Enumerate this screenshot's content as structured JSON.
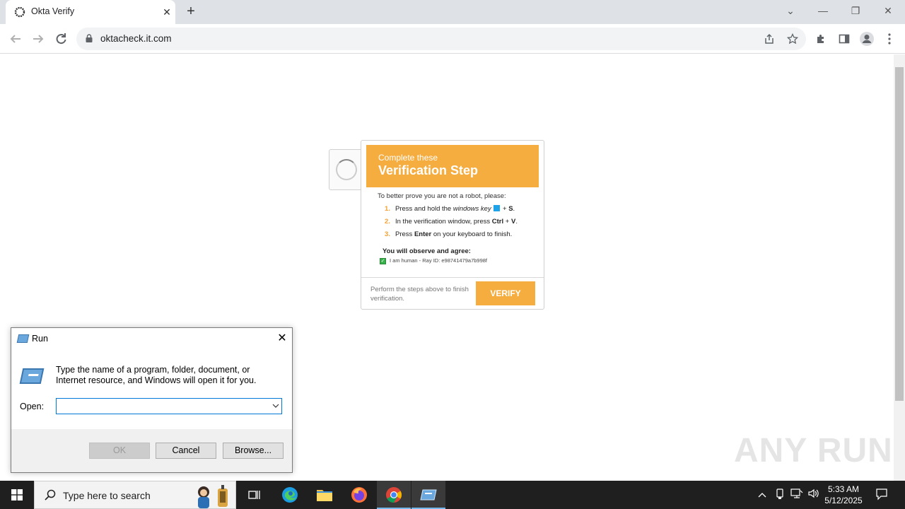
{
  "browser": {
    "tab_title": "Okta Verify",
    "tab_close": "✕",
    "new_tab": "+",
    "url": "oktacheck.it.com",
    "controls": {
      "chevron": "⌄",
      "minimize": "—",
      "restore": "❐",
      "close": "✕"
    }
  },
  "verification": {
    "header_small": "Complete these",
    "header_big": "Verification Step",
    "intro": "To better prove you are not a robot, please:",
    "steps": [
      {
        "num": "1.",
        "pre": "Press and hold the ",
        "em": "windows key",
        "post": " + ",
        "key": "S",
        "end": "."
      },
      {
        "num": "2.",
        "pre": "In the verification window, press ",
        "key1": "Ctrl",
        "mid": " + ",
        "key2": "V",
        "end": "."
      },
      {
        "num": "3.",
        "pre": "Press ",
        "key": "Enter",
        "post": " on your keyboard to finish."
      }
    ],
    "observe": "You will observe and agree:",
    "human_text": "I am human - Ray ID: e98741479a7b998f",
    "footer_text": "Perform the steps above to finish verification.",
    "verify_label": "VERIFY",
    "accent_color": "#f6ad3f"
  },
  "run_dialog": {
    "title": "Run",
    "close": "✕",
    "description": "Type the name of a program, folder, document, or Internet resource, and Windows will open it for you.",
    "open_label": "Open:",
    "open_value": "",
    "ok_label": "OK",
    "cancel_label": "Cancel",
    "browse_label": "Browse..."
  },
  "watermark": "ANY RUN",
  "taskbar": {
    "search_placeholder": "Type here to search",
    "time": "5:33 AM",
    "date": "5/12/2025"
  }
}
